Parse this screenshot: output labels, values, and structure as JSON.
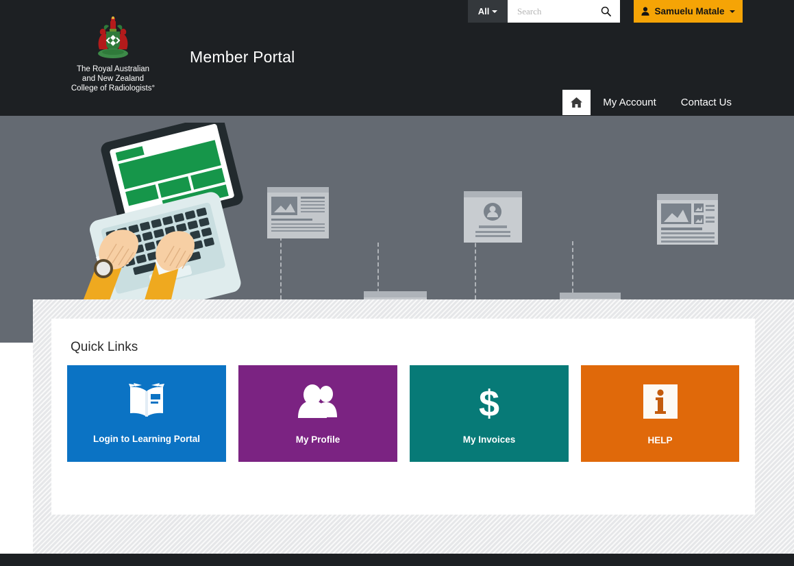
{
  "brand": {
    "logo_line1": "The Royal Australian",
    "logo_line2": "and New Zealand",
    "logo_line3": "College of Radiologists°",
    "crest_icon": "coat-of-arms-crest",
    "portal_title": "Member Portal"
  },
  "search": {
    "scope_label": "All",
    "placeholder": "Search",
    "value": "",
    "search_icon": "search-icon",
    "caret_icon": "chevron-down-icon"
  },
  "user": {
    "name": "Samuelu Matale",
    "avatar_icon": "user-icon",
    "caret_icon": "chevron-down-icon"
  },
  "nav": {
    "home_icon": "home-icon",
    "items": [
      {
        "label": "My Account"
      },
      {
        "label": "Contact Us"
      }
    ]
  },
  "banner": {
    "illustration": "laptop-hands-typing-illustration",
    "background_color": "#646a72",
    "cards": [
      {
        "name": "article-card-mockup"
      },
      {
        "name": "gallery-card-mockup"
      },
      {
        "name": "profile-card-mockup"
      },
      {
        "name": "list-card-mockup"
      },
      {
        "name": "media-card-mockup"
      }
    ]
  },
  "quick_links": {
    "title": "Quick Links",
    "tiles": [
      {
        "label": "Login to Learning Portal",
        "color": "#0b73c4",
        "icon": "open-book-icon"
      },
      {
        "label": "My Profile",
        "color": "#7b2382",
        "icon": "people-icon"
      },
      {
        "label": "My Invoices",
        "color": "#077a77",
        "icon": "dollar-sign-icon"
      },
      {
        "label": "HELP",
        "color": "#e0690a",
        "icon": "info-icon"
      }
    ]
  },
  "colors": {
    "header_dark": "#1d2023",
    "accent_gold": "#f5a406",
    "banner_grey": "#646a72",
    "stripe_grey": "#e6e7e9"
  }
}
